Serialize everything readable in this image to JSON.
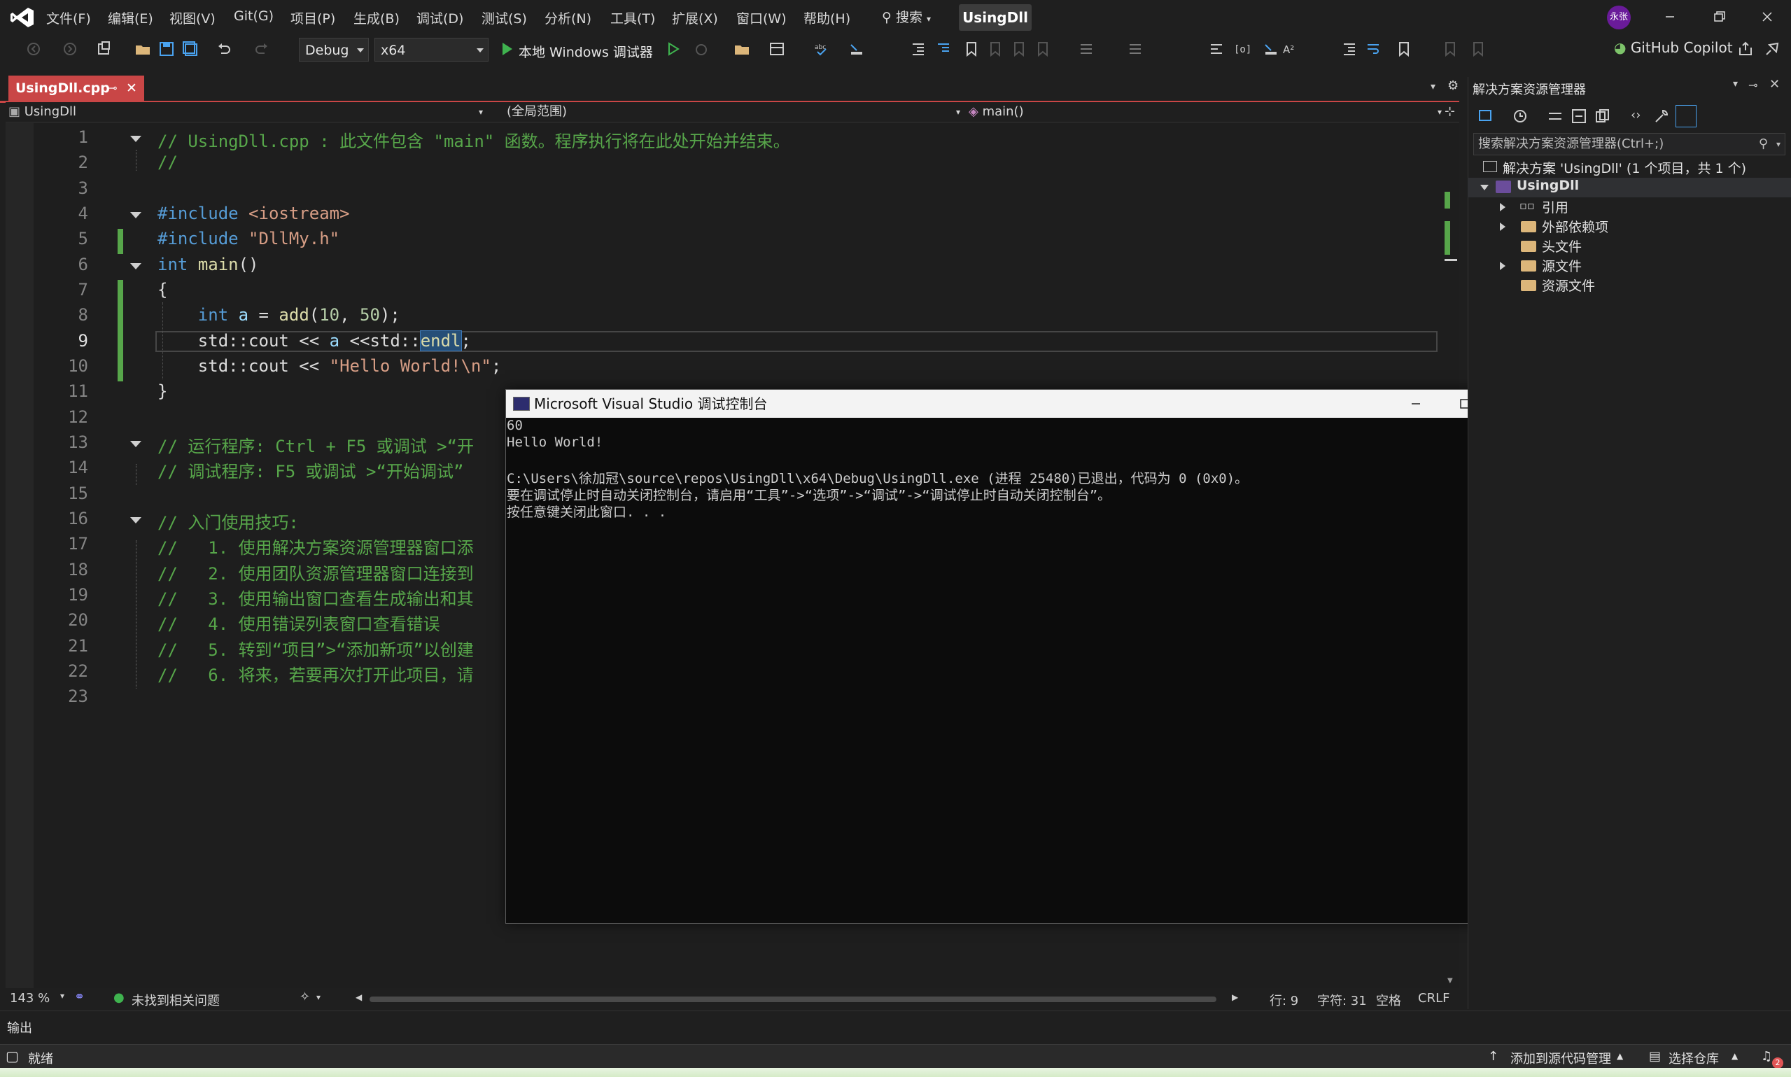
{
  "menubar": {
    "items": [
      "文件(F)",
      "编辑(E)",
      "视图(V)",
      "Git(G)",
      "项目(P)",
      "生成(B)",
      "调试(D)",
      "测试(S)",
      "分析(N)",
      "工具(T)",
      "扩展(X)",
      "窗口(W)",
      "帮助(H)"
    ],
    "search_label": "搜索",
    "solution_name": "UsingDll",
    "avatar_text": "永张"
  },
  "toolbar": {
    "configuration": "Debug",
    "platform": "x64",
    "run_label": "本地 Windows 调试器",
    "copilot_label": "GitHub Copilot"
  },
  "editor": {
    "tab_label": "UsingDll.cpp",
    "nav_project": "UsingDll",
    "nav_scope": "(全局范围)",
    "nav_member": "main()",
    "line_numbers": [
      "1",
      "2",
      "3",
      "4",
      "5",
      "6",
      "7",
      "8",
      "9",
      "10",
      "11",
      "12",
      "13",
      "14",
      "15",
      "16",
      "17",
      "18",
      "19",
      "20",
      "21",
      "22",
      "23"
    ],
    "comments": {
      "l1": "// UsingDll.cpp : 此文件包含 \"main\" 函数。程序执行将在此处开始并结束。",
      "l2": "//",
      "l13": "// 运行程序: Ctrl + F5 或调试 >“开",
      "l14": "// 调试程序: F5 或调试 >“开始调试”",
      "l16": "// 入门使用技巧:",
      "l17": "//   1. 使用解决方案资源管理器窗口添",
      "l18": "//   2. 使用团队资源管理器窗口连接到",
      "l19": "//   3. 使用输出窗口查看生成输出和其",
      "l20": "//   4. 使用错误列表窗口查看错误",
      "l21": "//   5. 转到“项目”>“添加新项”以创建",
      "l22": "//   6. 将来，若要再次打开此项目，请"
    },
    "tokens": {
      "include_kw": "#include",
      "iostream": "<iostream>",
      "dllmy": "\"DllMy.h\"",
      "int_kw": "int",
      "main_fn": "main",
      "parens": "()",
      "brace_open": "{",
      "brace_close": "}",
      "a_var": "a",
      "eq": " = ",
      "add_fn": "add",
      "ten": "10",
      "fifty": "50",
      "std_cout": "std::cout",
      "shift": " << ",
      "shift2": " <<",
      "std_ns": "std::",
      "endl": "endl",
      "semi": ";",
      "hello": "\"Hello World!\\n\"",
      "lp": "(",
      "comma": ", ",
      "rp": ")"
    },
    "zoom": "143 %",
    "issues": "未找到相关问题",
    "line_pos": "行: 9",
    "char_pos": "字符: 31",
    "whitespace": "空格",
    "eol": "CRLF"
  },
  "console": {
    "title": "Microsoft Visual Studio 调试控制台",
    "lines": [
      "60",
      "Hello World!",
      "",
      "C:\\Users\\徐加冠\\source\\repos\\UsingDll\\x64\\Debug\\UsingDll.exe (进程 25480)已退出，代码为 0 (0x0)。",
      "要在调试停止时自动关闭控制台，请启用“工具”->“选项”->“调试”->“调试停止时自动关闭控制台”。",
      "按任意键关闭此窗口. . ."
    ]
  },
  "solution_explorer": {
    "title": "解决方案资源管理器",
    "search_placeholder": "搜索解决方案资源管理器(Ctrl+;)",
    "solution_row": "解决方案 'UsingDll' (1 个项目，共 1 个)",
    "project_row": "UsingDll",
    "nodes": [
      "引用",
      "外部依赖项",
      "头文件",
      "源文件",
      "资源文件"
    ]
  },
  "output_label": "输出",
  "statusbar": {
    "ready": "就绪",
    "add_source": "添加到源代码管理",
    "select_repo": "选择仓库",
    "notif_count": "2"
  },
  "colors": {
    "accent_tab": "#c94646",
    "comment": "#57a64a",
    "keyword": "#569cd6"
  }
}
